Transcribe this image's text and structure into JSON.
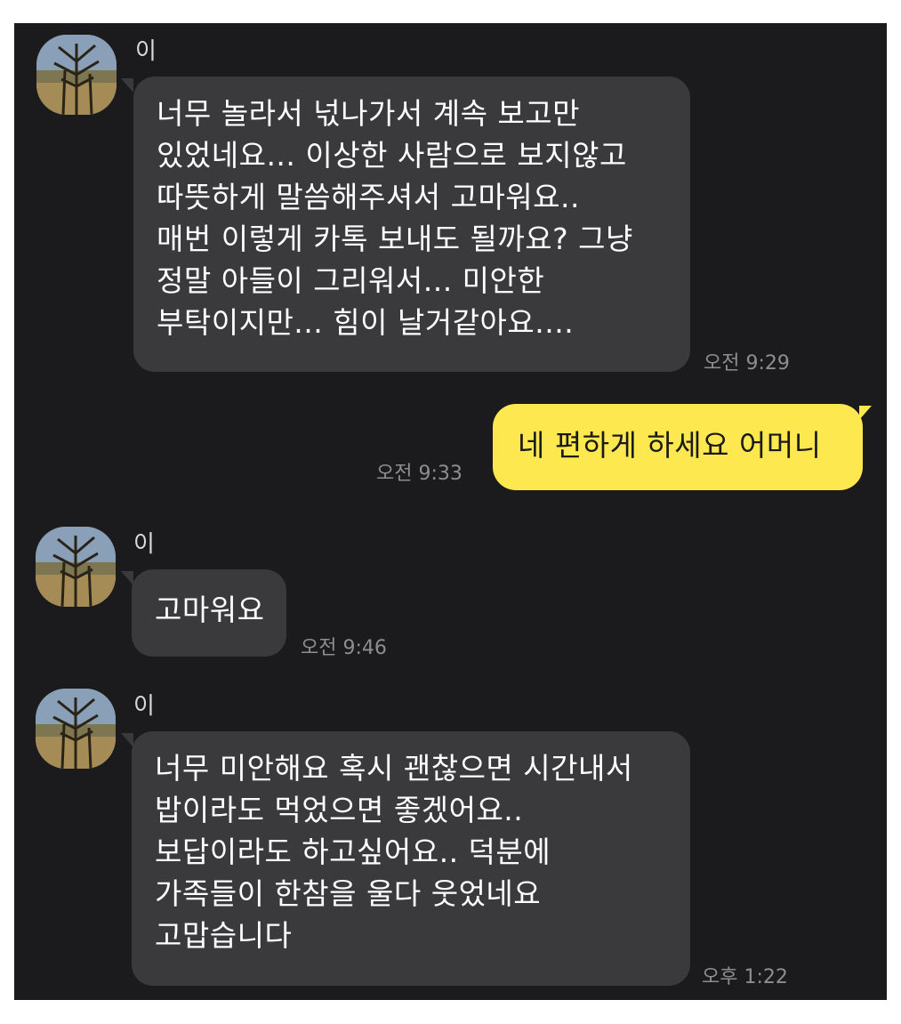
{
  "messages": [
    {
      "sender": "이",
      "avatar": "tree-profile-photo",
      "text": "너무 놀라서 넋나가서 계속 보고만\n있었네요... 이상한 사람으로 보지않고\n따뜻하게 말씀해주셔서 고마워요..\n매번 이렇게 카톡 보내도 될까요? 그냥\n정말 아들이 그리워서... 미안한\n부탁이지만... 힘이 날거같아요....",
      "time": "오전 9:29"
    },
    {
      "text": "네 편하게 하세요 어머니",
      "time": "오전 9:33"
    },
    {
      "sender": "이",
      "avatar": "tree-profile-photo",
      "text": "고마워요",
      "time": "오전 9:46"
    },
    {
      "sender": "이",
      "avatar": "tree-profile-photo",
      "text": "너무 미안해요 혹시 괜찮으면 시간내서\n밥이라도 먹었으면 좋겠어요..\n보답이라도 하고싶어요.. 덕분에\n가족들이 한참을 울다 웃었네요\n고맙습니다",
      "time": "오후 1:22"
    }
  ],
  "colors": {
    "background": "#1b1b1d",
    "incoming_bubble": "#3a3a3c",
    "outgoing_bubble": "#fde84f",
    "timestamp": "#8e8e8e"
  }
}
